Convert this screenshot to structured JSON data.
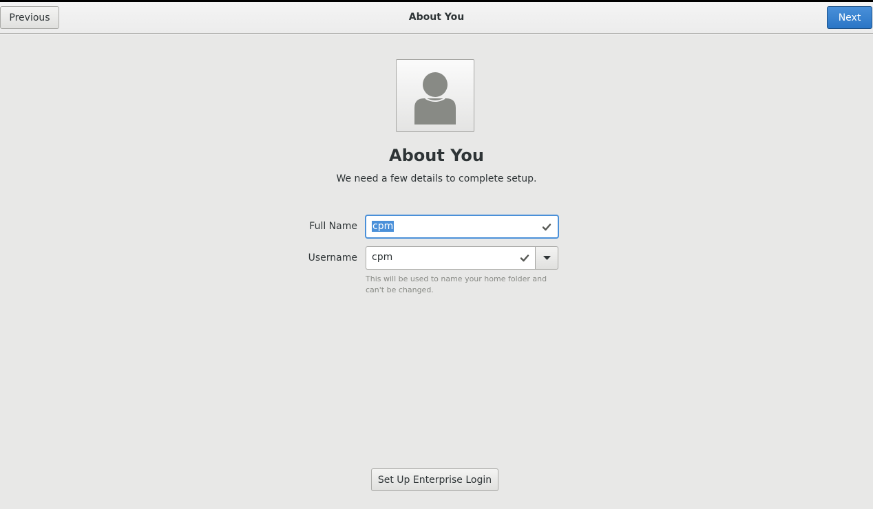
{
  "header": {
    "title": "About You",
    "previous_label": "Previous",
    "next_label": "Next",
    "next_color": "#2a76c6"
  },
  "main": {
    "avatar_icon": "user-avatar-icon",
    "title": "About You",
    "subtitle": "We need a few details to complete setup.",
    "full_name": {
      "label": "Full Name",
      "value": "cpm",
      "selected": true,
      "status_icon": "check-icon"
    },
    "username": {
      "label": "Username",
      "value": "cpm",
      "status_icon": "check-icon",
      "dropdown_icon": "caret-down-icon"
    },
    "hint": "This will be used to name your home folder and can't be changed.",
    "enterprise_login_label": "Set Up Enterprise Login"
  },
  "colors": {
    "background": "#e8e8e7",
    "accent": "#4a90d9",
    "text": "#2e3436",
    "hint_text": "#888a85"
  }
}
